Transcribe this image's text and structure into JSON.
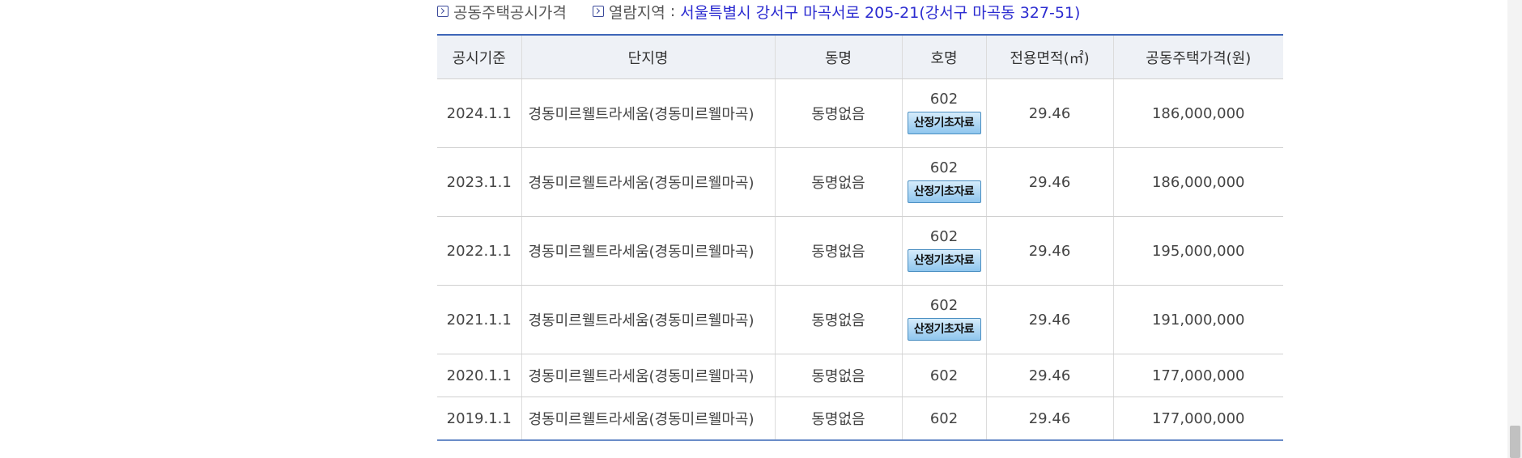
{
  "header": {
    "item1_label": "공동주택공시가격",
    "item2_label": "열람지역",
    "item2_separator": ":",
    "item2_value": "서울특별시 강서구 마곡서로 205-21(강서구 마곡동 327-51)"
  },
  "table": {
    "columns": [
      "공시기준",
      "단지명",
      "동명",
      "호명",
      "전용면적(㎡)",
      "공동주택가격(원)"
    ],
    "button_label": "산정기초자료",
    "rows": [
      {
        "date": "2024.1.1",
        "complex": "경동미르웰트라세움(경동미르웰마곡)",
        "dong": "동명없음",
        "ho": "602",
        "area": "29.46",
        "price": "186,000,000",
        "has_button": true
      },
      {
        "date": "2023.1.1",
        "complex": "경동미르웰트라세움(경동미르웰마곡)",
        "dong": "동명없음",
        "ho": "602",
        "area": "29.46",
        "price": "186,000,000",
        "has_button": true
      },
      {
        "date": "2022.1.1",
        "complex": "경동미르웰트라세움(경동미르웰마곡)",
        "dong": "동명없음",
        "ho": "602",
        "area": "29.46",
        "price": "195,000,000",
        "has_button": true
      },
      {
        "date": "2021.1.1",
        "complex": "경동미르웰트라세움(경동미르웰마곡)",
        "dong": "동명없음",
        "ho": "602",
        "area": "29.46",
        "price": "191,000,000",
        "has_button": true
      },
      {
        "date": "2020.1.1",
        "complex": "경동미르웰트라세움(경동미르웰마곡)",
        "dong": "동명없음",
        "ho": "602",
        "area": "29.46",
        "price": "177,000,000",
        "has_button": false
      },
      {
        "date": "2019.1.1",
        "complex": "경동미르웰트라세움(경동미르웰마곡)",
        "dong": "동명없음",
        "ho": "602",
        "area": "29.46",
        "price": "177,000,000",
        "has_button": false
      }
    ]
  },
  "colors": {
    "accent": "#3e66b8",
    "link_text": "#2b2bd0",
    "header_bg": "#eef1f6",
    "button_bg": "#8fc6ee"
  },
  "icons": {
    "header_bullet": "arrow-box-icon"
  }
}
